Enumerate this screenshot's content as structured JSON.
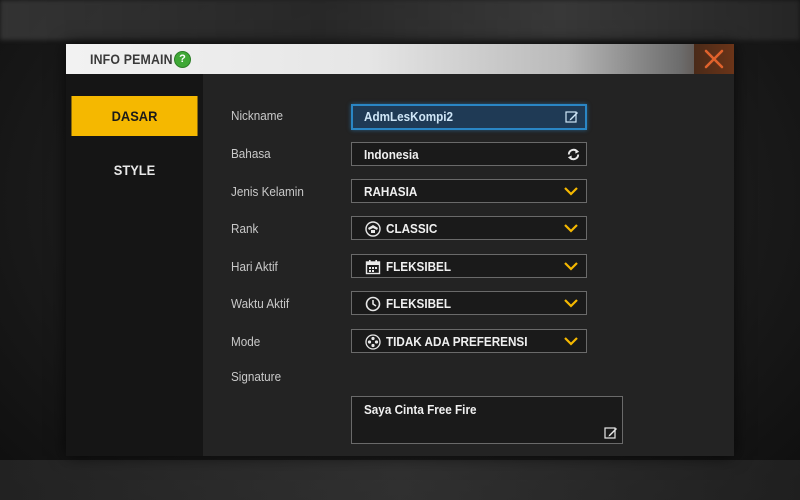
{
  "header": {
    "title": "INFO PEMAIN",
    "help_icon": "?"
  },
  "sidebar": {
    "tabs": [
      {
        "label": "DASAR",
        "active": true
      },
      {
        "label": "STYLE",
        "active": false
      }
    ]
  },
  "form": {
    "nickname": {
      "label": "Nickname",
      "value": "AdmLesKompi2"
    },
    "language": {
      "label": "Bahasa",
      "value": "Indonesia"
    },
    "gender": {
      "label": "Jenis Kelamin",
      "value": "RAHASIA"
    },
    "rank": {
      "label": "Rank",
      "value": "CLASSIC",
      "icon": "rank-icon"
    },
    "active_days": {
      "label": "Hari Aktif",
      "value": "FLEKSIBEL",
      "icon": "calendar-icon"
    },
    "active_time": {
      "label": "Waktu Aktif",
      "value": "FLEKSIBEL",
      "icon": "clock-icon"
    },
    "mode": {
      "label": "Mode",
      "value": "TIDAK ADA PREFERENSI",
      "icon": "mode-icon"
    },
    "signature": {
      "label": "Signature",
      "value": "Saya Cinta Free Fire"
    }
  },
  "colors": {
    "accent": "#f5b800",
    "close": "#e0622c",
    "chevron": "#f5b800",
    "input_focus": "#2a86c5"
  }
}
